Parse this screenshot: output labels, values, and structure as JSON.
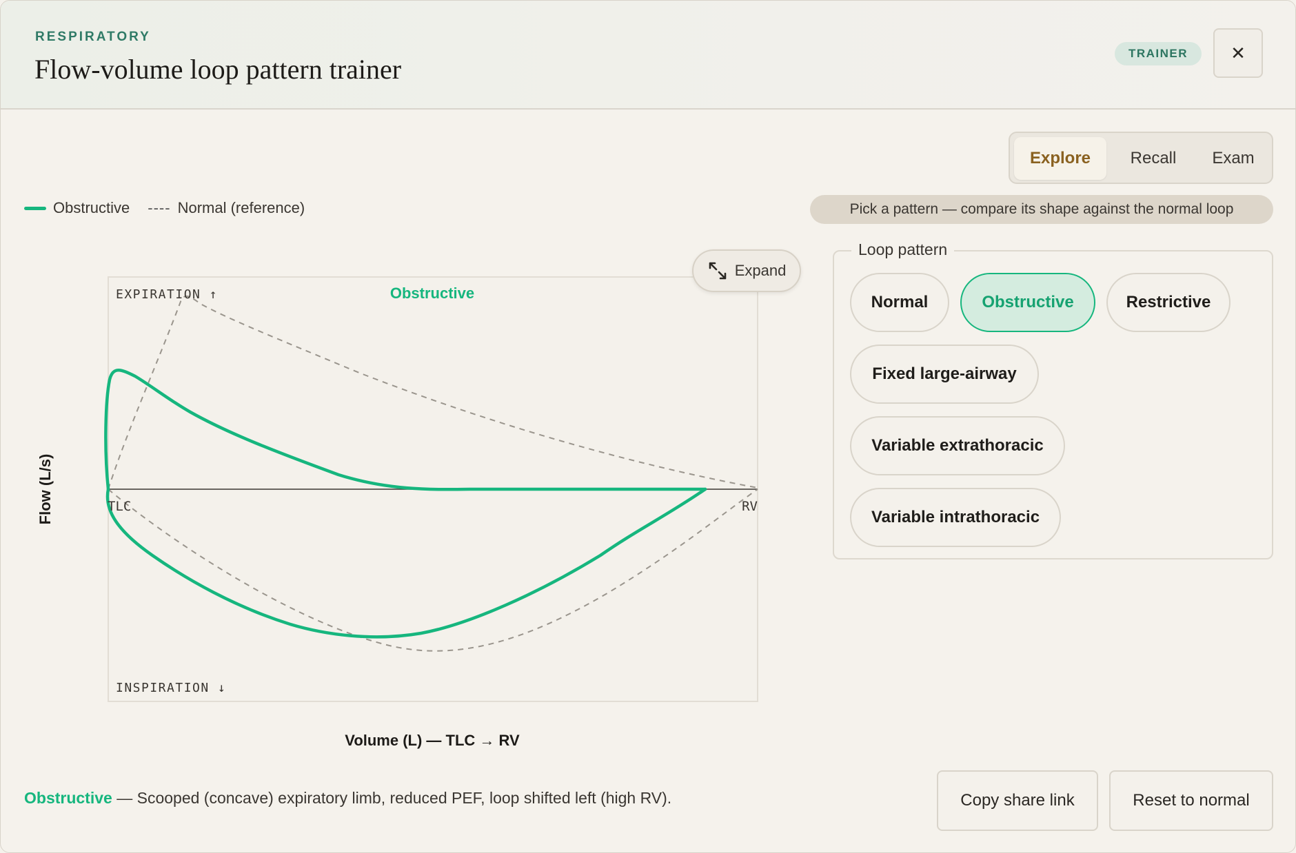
{
  "header": {
    "eyebrow": "RESPIRATORY",
    "title": "Flow-volume loop pattern trainer",
    "badge": "TRAINER",
    "close_glyph": "✕"
  },
  "modes": {
    "items": [
      "Explore",
      "Recall",
      "Exam"
    ],
    "active": "Explore"
  },
  "legend": {
    "solid_label": "Obstructive",
    "dash_glyph": "----",
    "dash_label": "Normal (reference)"
  },
  "hint": "Pick a pattern — compare its shape against the normal loop",
  "expand_label": "Expand",
  "panel": {
    "legend": "Loop pattern",
    "patterns": [
      "Normal",
      "Obstructive",
      "Restrictive",
      "Fixed large-airway",
      "Variable extrathoracic",
      "Variable intrathoracic"
    ],
    "selected": "Obstructive"
  },
  "chart_data": {
    "type": "line",
    "title": "Obstructive",
    "xlabel": "Volume (L) — TLC → RV",
    "ylabel": "Flow (L/s)",
    "top_annotation": "EXPIRATION ↑",
    "bottom_annotation": "INSPIRATION ↓",
    "x_left_label": "TLC",
    "x_right_label": "RV",
    "series": [
      {
        "name": "Obstructive",
        "style": "solid",
        "color": "#16b67e"
      },
      {
        "name": "Normal (reference)",
        "style": "dashed",
        "color": "#9a958d"
      }
    ]
  },
  "footer": {
    "pattern": "Obstructive",
    "description": " — Scooped (concave) expiratory limb, reduced PEF, loop shifted left (high RV).",
    "copy_label": "Copy share link",
    "reset_label": "Reset to normal"
  },
  "colors": {
    "accent": "#16b67e",
    "eyebrow": "#2f7a66",
    "active_mode": "#8a6120"
  }
}
